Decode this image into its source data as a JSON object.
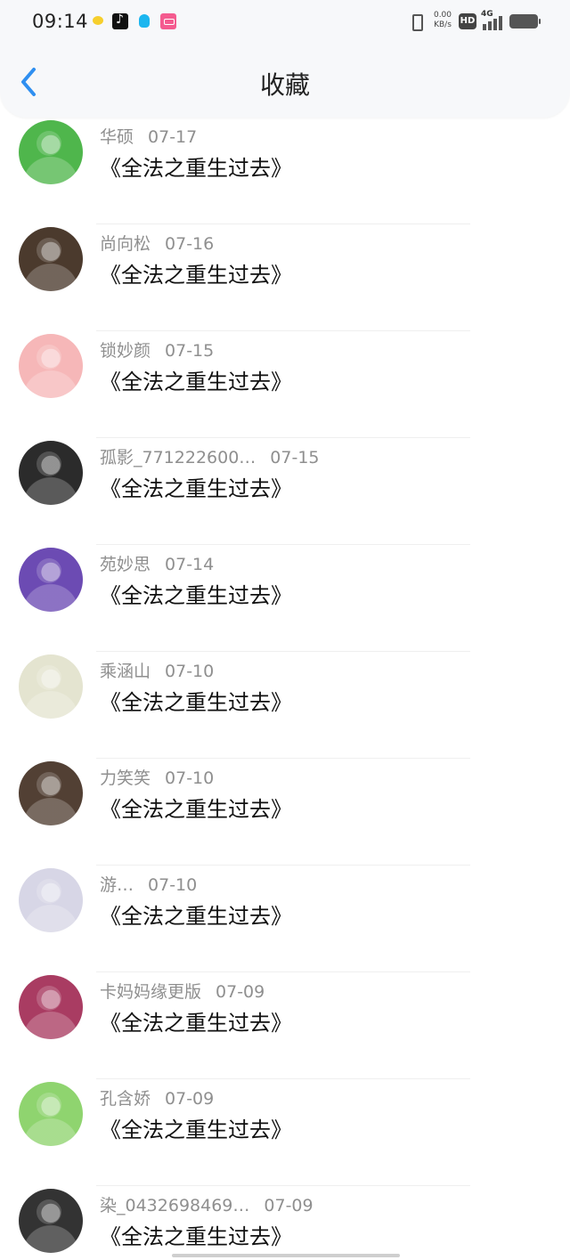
{
  "status_bar": {
    "time": "09:14",
    "net_speed_value": "0.00",
    "net_speed_unit": "KB/s",
    "hd_label": "HD",
    "network_label": "4G",
    "app_icons": [
      "pinduoduo-icon",
      "tiktok-icon",
      "qq-icon",
      "lofter-icon"
    ],
    "colors": {
      "background": "#f7f8fa",
      "text": "#222222"
    }
  },
  "header": {
    "title": "收藏",
    "back_icon": "chevron-left-icon",
    "accent_color": "#2f8ff0"
  },
  "list": {
    "items": [
      {
        "name": "华硕",
        "date": "07-17",
        "title": "《全法之重生过去》",
        "avatar_color": "#4fb64c"
      },
      {
        "name": "尚向松",
        "date": "07-16",
        "title": "《全法之重生过去》",
        "avatar_color": "#4b3a2d"
      },
      {
        "name": "锁妙颜",
        "date": "07-15",
        "title": "《全法之重生过去》",
        "avatar_color": "#f6b7b8"
      },
      {
        "name": "孤影_771222600…",
        "date": "07-15",
        "title": "《全法之重生过去》",
        "avatar_color": "#2b2b2b"
      },
      {
        "name": "苑妙思",
        "date": "07-14",
        "title": "《全法之重生过去》",
        "avatar_color": "#6c4bb3"
      },
      {
        "name": "乘涵山",
        "date": "07-10",
        "title": "《全法之重生过去》",
        "avatar_color": "#e4e4d0"
      },
      {
        "name": "力笑笑",
        "date": "07-10",
        "title": "《全法之重生过去》",
        "avatar_color": "#524034"
      },
      {
        "name": "游…",
        "date": "07-10",
        "title": "《全法之重生过去》",
        "avatar_color": "#d7d6e6"
      },
      {
        "name": "卡妈妈缘更版",
        "date": "07-09",
        "title": "《全法之重生过去》",
        "avatar_color": "#a93c62"
      },
      {
        "name": "孔含娇",
        "date": "07-09",
        "title": "《全法之重生过去》",
        "avatar_color": "#8fd46f"
      },
      {
        "name": "染_0432698469…",
        "date": "07-09",
        "title": "《全法之重生过去》",
        "avatar_color": "#333333"
      }
    ],
    "colors": {
      "name_text": "#8f8f8f",
      "title_text": "#111111",
      "divider": "#efefef"
    }
  }
}
